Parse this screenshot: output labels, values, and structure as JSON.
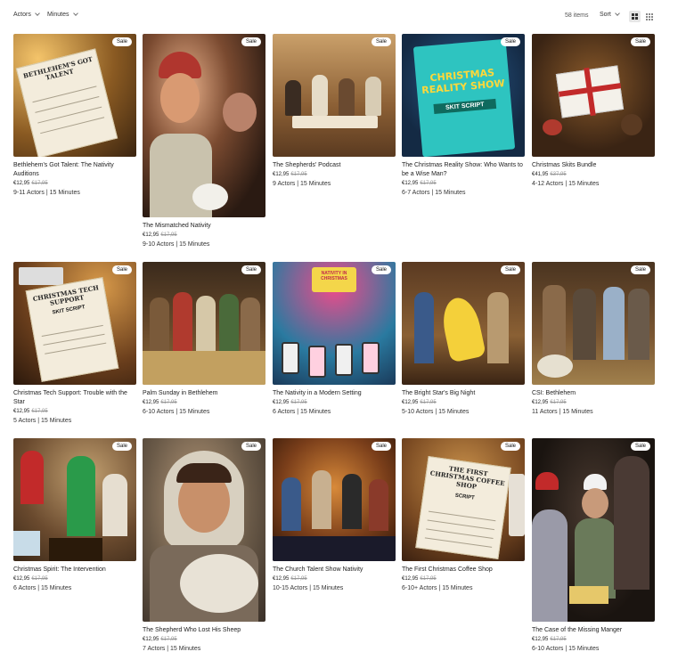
{
  "toolbar": {
    "filters": [
      {
        "label": "Actors"
      },
      {
        "label": "Minutes"
      }
    ],
    "count": "58 items",
    "sort_label": "Sort"
  },
  "sale_badge": "Sale",
  "products": [
    {
      "title": "Bethlehem's Got Talent: The Nativity Auditions",
      "price": "€12,95",
      "old_price": "€17,95",
      "meta": "9-11 Actors | 15 Minutes",
      "art_text": "BETHLEHEM'S GOT TALENT"
    },
    {
      "title": "The Mismatched Nativity",
      "price": "€12,95",
      "old_price": "€17,95",
      "meta": "9-10 Actors | 15 Minutes"
    },
    {
      "title": "The Shepherds' Podcast",
      "price": "€12,95",
      "old_price": "€17,95",
      "meta": "9 Actors | 15 Minutes"
    },
    {
      "title": "The Christmas Reality Show: Who Wants to be a Wise Man?",
      "price": "€12,95",
      "old_price": "€17,95",
      "meta": "6-7 Actors | 15 Minutes",
      "art_text": "CHRISTMAS REALITY SHOW",
      "art_sub": "SKIT SCRIPT"
    },
    {
      "title": "Christmas Skits Bundle",
      "price": "€41,95",
      "old_price": "€37,95",
      "meta": "4-12 Actors | 15 Minutes"
    },
    {
      "title": "Christmas Tech Support: Trouble with the Star",
      "price": "€12,95",
      "old_price": "€17,95",
      "meta": "5 Actors | 15 Minutes",
      "art_text": "CHRISTMAS TECH SUPPORT",
      "art_sub": "SKIT SCRIPT"
    },
    {
      "title": "Palm Sunday in Bethlehem",
      "price": "€12,95",
      "old_price": "€17,95",
      "meta": "6-10 Actors | 15 Minutes"
    },
    {
      "title": "The Nativity in a Modern Setting",
      "price": "€12,95",
      "old_price": "€17,95",
      "meta": "6 Actors | 15 Minutes",
      "art_text": "NATIVITY IN CHRISTMAS"
    },
    {
      "title": "The Bright Star's Big Night",
      "price": "€12,95",
      "old_price": "€17,95",
      "meta": "5-10 Actors | 15 Minutes"
    },
    {
      "title": "CSI: Bethlehem",
      "price": "€12,95",
      "old_price": "€17,95",
      "meta": "11 Actors | 15 Minutes"
    },
    {
      "title": "Christmas Spirit: The Intervention",
      "price": "€12,95",
      "old_price": "€17,95",
      "meta": "6 Actors | 15 Minutes"
    },
    {
      "title": "The Shepherd Who Lost His Sheep",
      "price": "€12,95",
      "old_price": "€17,95",
      "meta": "7 Actors | 15 Minutes"
    },
    {
      "title": "The Church Talent Show Nativity",
      "price": "€12,95",
      "old_price": "€17,95",
      "meta": "10-15 Actors | 15 Minutes"
    },
    {
      "title": "The First Christmas Coffee Shop",
      "price": "€12,95",
      "old_price": "€17,95",
      "meta": "6-10+ Actors | 15 Minutes",
      "art_text": "THE FIRST CHRISTMAS COFFEE SHOP",
      "art_sub": "SCRIPT"
    },
    {
      "title": "The Case of the Missing Manger",
      "price": "€12,95",
      "old_price": "€17,95",
      "meta": "6-10 Actors | 15 Minutes"
    }
  ],
  "colors": {
    "accent": "#e6e6e6",
    "badge_bg": "#ffffff",
    "strike": "#999999"
  }
}
